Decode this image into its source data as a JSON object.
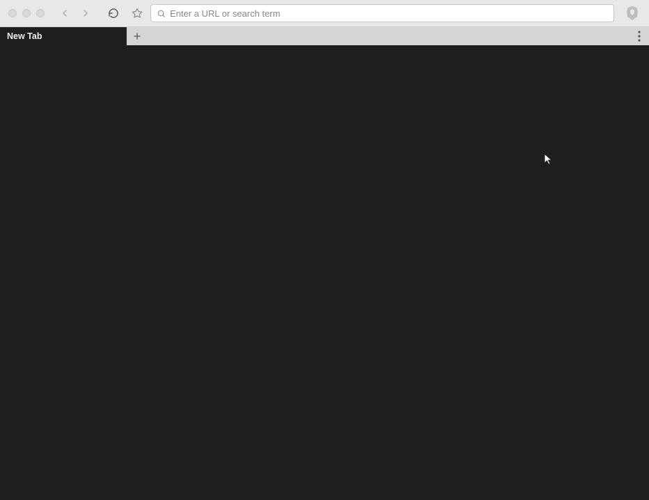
{
  "toolbar": {
    "address_placeholder": "Enter a URL or search term",
    "address_value": ""
  },
  "tabs": {
    "items": [
      {
        "label": "New Tab"
      }
    ]
  }
}
